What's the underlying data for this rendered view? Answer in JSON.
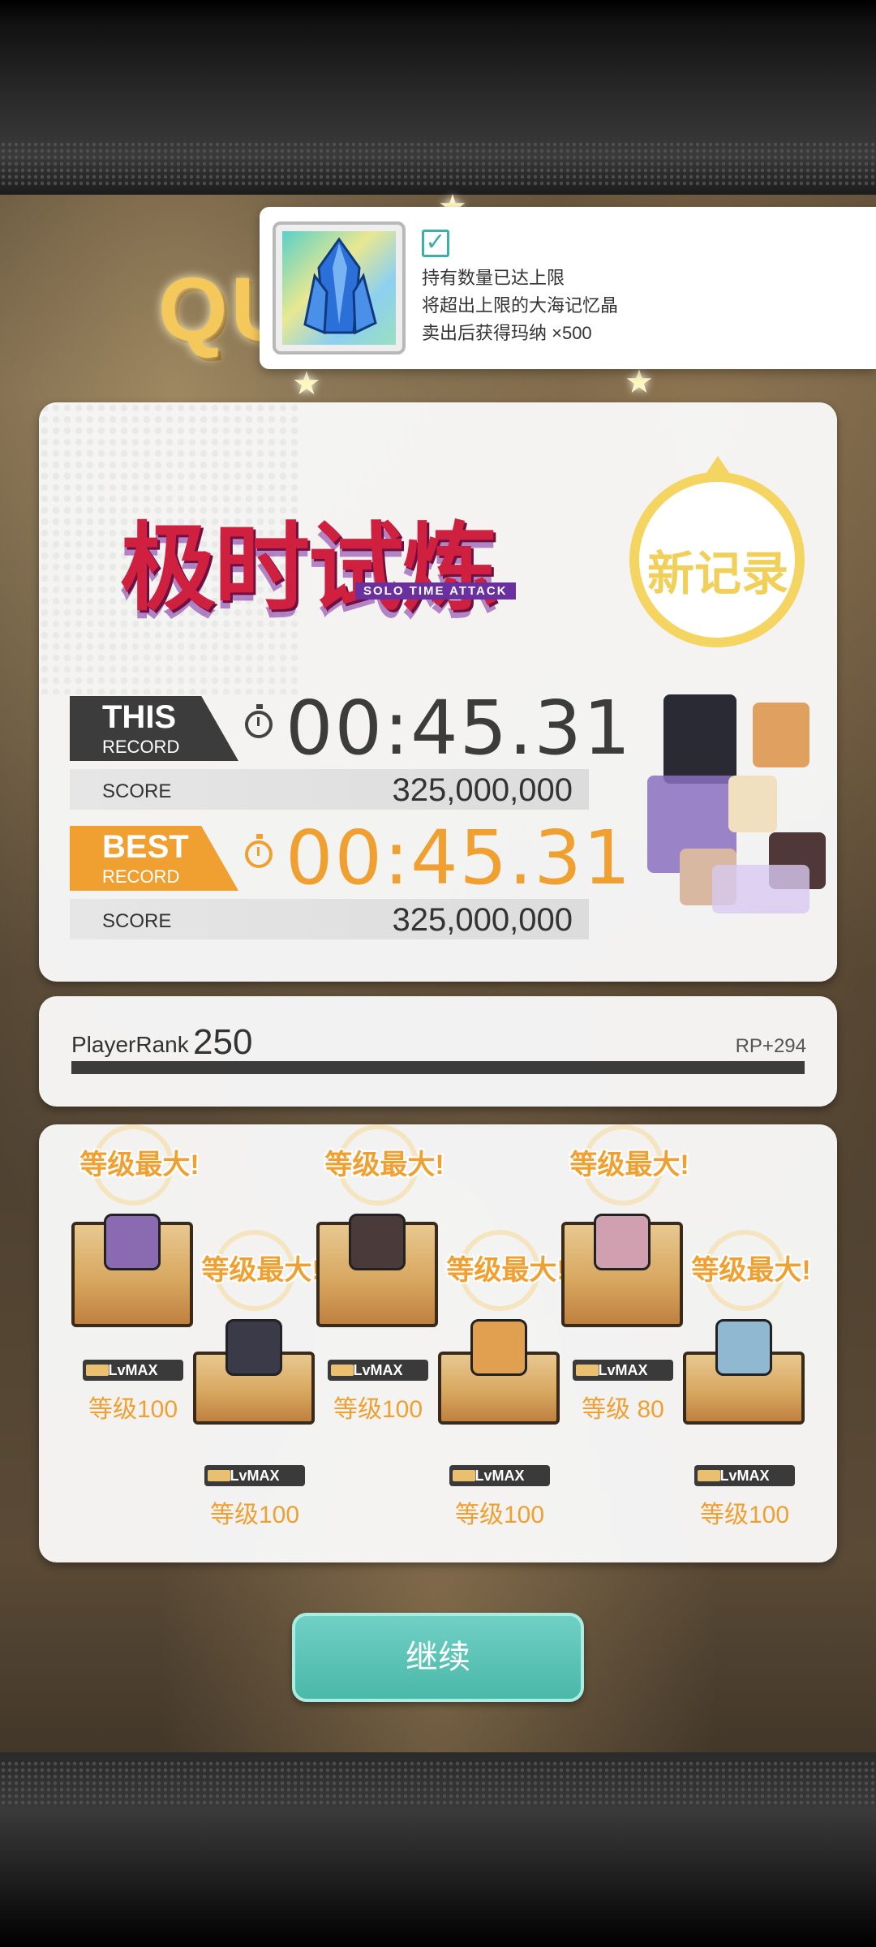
{
  "notification": {
    "item_icon": "blue-crystal-icon",
    "check_icon": "checkbox-checked-icon",
    "line1": "持有数量已达上限",
    "line2": "将超出上限的大海记忆晶",
    "line3": "卖出后获得玛纳 ×500"
  },
  "background": {
    "quest_partial": "QU"
  },
  "record": {
    "title_cn": "极时试炼",
    "title_en": "SOLO TIME ATTACK",
    "new_record": "新记录",
    "this_label": "THIS",
    "this_sub": "RECORD",
    "this_time": "00:45.31",
    "this_score_label": "SCORE",
    "this_score": "325,000,000",
    "best_label": "BEST",
    "best_sub": "RECORD",
    "best_time": "00:45.31",
    "best_score_label": "SCORE",
    "best_score": "325,000,000"
  },
  "rank": {
    "label": "PlayerRank",
    "value": "250",
    "rp": "RP+294",
    "progress": 1.0
  },
  "characters": [
    {
      "max_label": "等级最大!",
      "lv_badge": "LvMAX",
      "level": "等级100",
      "color": "#8a6ab0"
    },
    {
      "max_label": "等级最大!",
      "lv_badge": "LvMAX",
      "level": "等级100",
      "color": "#3a3a48"
    },
    {
      "max_label": "等级最大!",
      "lv_badge": "LvMAX",
      "level": "等级100",
      "color": "#4a3a3a"
    },
    {
      "max_label": "等级最大!",
      "lv_badge": "LvMAX",
      "level": "等级100",
      "color": "#e0a050"
    },
    {
      "max_label": "等级最大!",
      "lv_badge": "LvMAX",
      "level": "等级 80",
      "color": "#d0a0b0"
    },
    {
      "max_label": "等级最大!",
      "lv_badge": "LvMAX",
      "level": "等级100",
      "color": "#90b8d0"
    }
  ],
  "continue_button": "继续",
  "colors": {
    "accent_orange": "#f0a030",
    "dark_gray": "#3c3c3c",
    "teal": "#4ab8aa",
    "gold": "#f5d562"
  }
}
